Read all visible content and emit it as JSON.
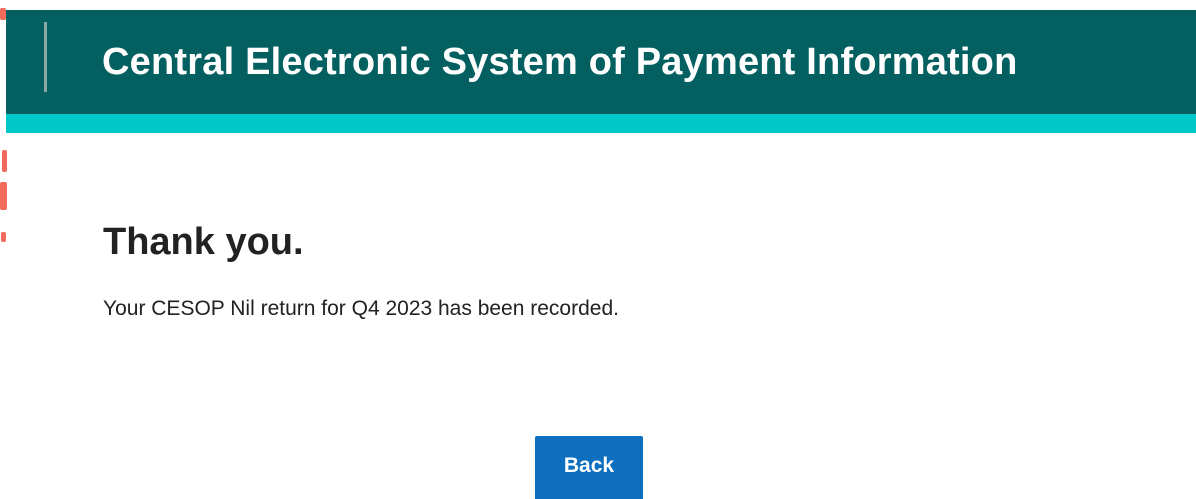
{
  "header": {
    "title": "Central Electronic System of Payment Information"
  },
  "confirmation": {
    "heading": "Thank you.",
    "message": "Your CESOP Nil return for Q4 2023 has been recorded."
  },
  "actions": {
    "back_label": "Back"
  },
  "colors": {
    "header_background": "#045f61",
    "accent_bar": "#00c8c8",
    "button_primary": "#0d6fbd",
    "text_primary": "#222222"
  }
}
